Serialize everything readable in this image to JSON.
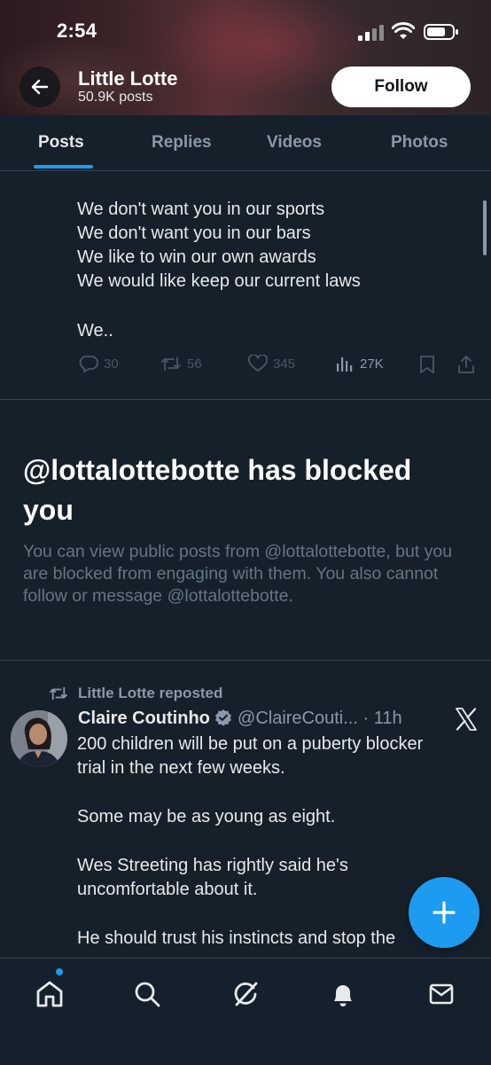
{
  "status_bar": {
    "time": "2:54"
  },
  "header": {
    "name": "Little Lotte",
    "posts_count": "50.9K posts",
    "follow_label": "Follow"
  },
  "tabs": [
    {
      "label": "Posts",
      "active": true
    },
    {
      "label": "Replies",
      "active": false
    },
    {
      "label": "Videos",
      "active": false
    },
    {
      "label": "Photos",
      "active": false
    }
  ],
  "post": {
    "lines": [
      "We don't want you in our sports",
      "We don't want you in our bars",
      "We like to win our own awards",
      "We would like keep our current laws",
      "We.."
    ],
    "actions": {
      "replies": "30",
      "reposts": "56",
      "likes": "345",
      "views": "27K"
    }
  },
  "block_notice": {
    "title": "@lottalottebotte has blocked you",
    "description": "You can view public posts from @lottalottebotte, but you are blocked from engaging with them. You also cannot follow or message @lottalottebotte."
  },
  "repost": {
    "label": "Little Lotte reposted",
    "author_name": "Claire Coutinho",
    "author_handle": "@ClaireCouti...",
    "time": "· 11h",
    "lines": [
      "200 children will be put on a puberty blocker",
      "trial in the next few weeks.",
      "Some may be as young as eight.",
      "Wes Streeting has rightly said he's",
      "uncomfortable about it.",
      "He should trust his instincts and stop the"
    ]
  },
  "colors": {
    "background": "#15202b",
    "accent": "#1d9bf0",
    "muted": "#8b98a5"
  },
  "icons": [
    "back-arrow-icon",
    "reply-icon",
    "repost-icon",
    "like-icon",
    "views-icon",
    "bookmark-icon",
    "share-icon",
    "verified-badge-icon",
    "x-logo-icon",
    "compose-plus-icon",
    "home-icon",
    "search-icon",
    "grok-icon",
    "notifications-icon",
    "messages-icon"
  ]
}
